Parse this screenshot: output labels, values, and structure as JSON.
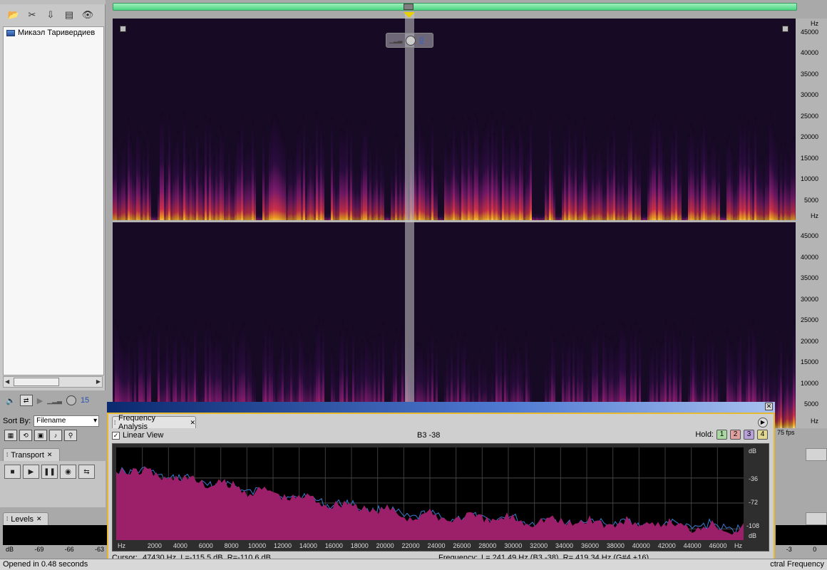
{
  "files_panel": {
    "file_name": "Микаэл Таривердиев",
    "time_value": "15",
    "sort_by_label": "Sort By:",
    "sort_by_value": "Filename"
  },
  "transport": {
    "tab_label": "Transport"
  },
  "levels": {
    "tab_label": "Levels",
    "scale": [
      "dB",
      "-69",
      "-66",
      "-63"
    ],
    "scale_right": [
      "-3",
      "0"
    ]
  },
  "status": {
    "left": "Opened in 0.48 seconds",
    "right": "ctral Frequency"
  },
  "spectral": {
    "hud_value": "0",
    "fps_label": "75 fps",
    "hz_unit": "Hz",
    "hz_top": [
      "45000",
      "40000",
      "35000",
      "30000",
      "25000",
      "20000",
      "15000",
      "10000",
      "5000"
    ],
    "hz_bottom": [
      "45000",
      "40000",
      "35000",
      "30000",
      "25000",
      "20000",
      "15000",
      "10000",
      "5000"
    ]
  },
  "frequency_analysis": {
    "tab_label": "Frequency Analysis",
    "linear_view_label": "Linear View",
    "linear_view_checked": true,
    "note": "B3 -38",
    "hold_label": "Hold:",
    "hold_buttons": [
      "1",
      "2",
      "3",
      "4"
    ],
    "hold_colors": [
      "#a8d8a0",
      "#e0a0a0",
      "#b8a0d8",
      "#e0d890"
    ],
    "db_labels": [
      "dB",
      "-36",
      "-72",
      "-108",
      "dB"
    ],
    "x_unit": "Hz",
    "x_labels": [
      "2000",
      "4000",
      "6000",
      "8000",
      "10000",
      "12000",
      "14000",
      "16000",
      "18000",
      "20000",
      "22000",
      "24000",
      "26000",
      "28000",
      "30000",
      "32000",
      "34000",
      "36000",
      "38000",
      "40000",
      "42000",
      "44000",
      "46000"
    ],
    "cursor_label": "Cursor:",
    "cursor_value": "47430 Hz, L=-115.5 dB, R=-110.6 dB",
    "frequency_label": "Frequency:",
    "frequency_value": "L= 241.49 Hz (B3 -38), R= 419.34 Hz (G#4 +16)",
    "series_colors": {
      "left": "#9c1f6a",
      "right": "#3a7cd0"
    }
  }
}
